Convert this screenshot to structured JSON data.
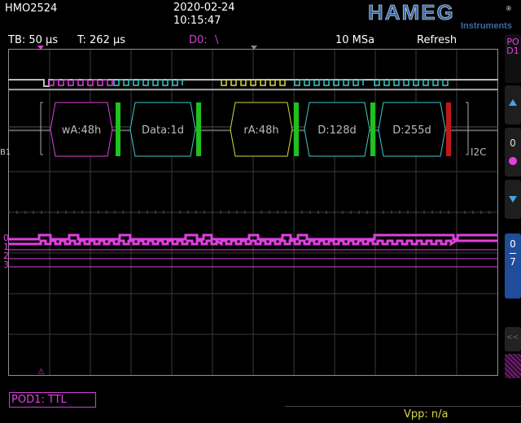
{
  "header": {
    "model": "HMO2524",
    "date": "2020-02-24",
    "time": "10:15:47",
    "brand": "HAMEG",
    "brand_sub": "Instruments",
    "brand_reg": "®"
  },
  "status_bar": {
    "timebase": "TB: 50 µs",
    "trigger_time": "T: 262 µs",
    "trigger_source": "D0:",
    "trigger_edge": "\\",
    "sample_rate": "10 MSa",
    "acq_mode": "Refresh"
  },
  "bus": {
    "label": "B1",
    "protocol": "I2C",
    "frames": [
      "wA:48h",
      "Data:1d",
      "rA:48h",
      "D:128d",
      "D:255d"
    ]
  },
  "channels": {
    "labels": [
      "0",
      "1",
      "2",
      "3"
    ]
  },
  "right_panel": {
    "pod_label": "POD1",
    "up_icon": "triangle-up-icon",
    "level_value": "0",
    "down_icon": "triangle-down-icon",
    "range_top": "0",
    "range_bottom": "7"
  },
  "footer": {
    "pod_setting": "POD1: TTL",
    "vpp": "Vpp: n/a"
  },
  "colors": {
    "magenta": "#e040e0",
    "cyan": "#40c8c8",
    "yellow": "#d8d840",
    "green": "#20c020",
    "red": "#c01818",
    "brand_blue": "#2a4f8a"
  }
}
